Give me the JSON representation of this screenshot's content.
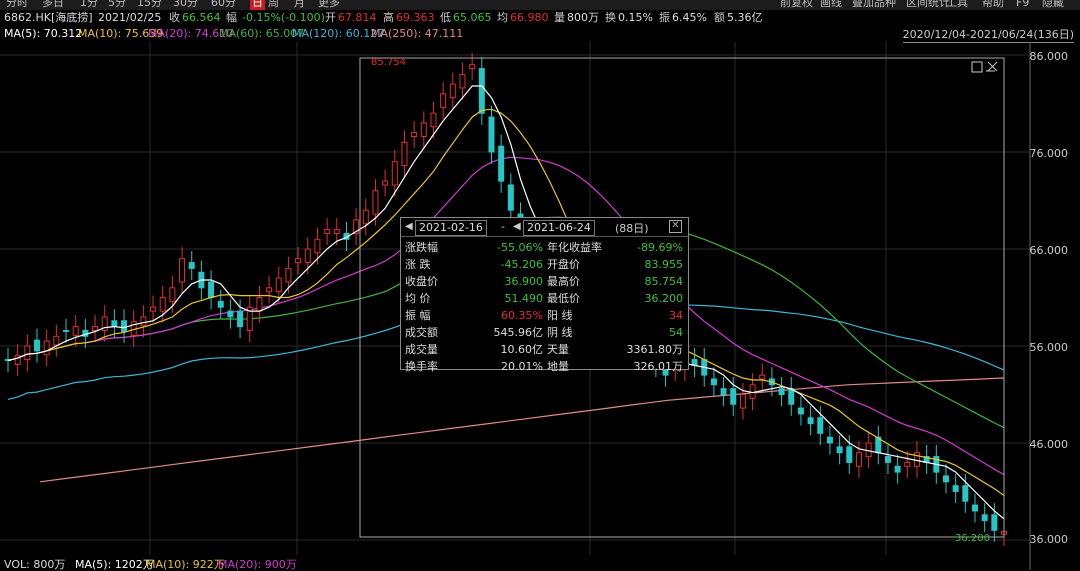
{
  "toolbar": {
    "periods": [
      "分时",
      "多日",
      "1分",
      "5分",
      "15分",
      "30分",
      "60分",
      "日",
      "周",
      "月",
      "更多"
    ],
    "active_period": "日",
    "right_buttons": [
      "前复权",
      "画线",
      "叠加品种",
      "区间统计",
      "工具",
      "帮助",
      "F9",
      "隐藏"
    ]
  },
  "info": {
    "symbol": "6862.HK[海底捞]",
    "date": "2021/02/25",
    "close_label": "收",
    "close": "66.564",
    "change_label": "幅",
    "change": "-0.15%(-0.100)",
    "open_label": "开",
    "open": "67.814",
    "high_label": "高",
    "high": "69.363",
    "low_label": "低",
    "low": "65.065",
    "avg_label": "均",
    "avg": "66.980",
    "volume_label": "量",
    "volume": "800万",
    "turnover_label": "换",
    "turnover": "0.15%",
    "amplitude_label": "振",
    "amplitude": "6.45%",
    "amount_label": "额",
    "amount": "5.36亿"
  },
  "ma": [
    {
      "label": "MA(5): 70.312",
      "color": "#ffffff"
    },
    {
      "label": "MA(10): 75.639",
      "color": "#e8c430"
    },
    {
      "label": "MA(20): 74.610",
      "color": "#d23cd2"
    },
    {
      "label": "MA(60): 65.007",
      "color": "#3fb43f"
    },
    {
      "label": "MA(120): 60.127",
      "color": "#3fb4d6"
    },
    {
      "label": "MA(250): 47.111",
      "color": "#e08a8a"
    }
  ],
  "range_label": "2020/12/04-2021/06/24(136日)",
  "y_axis": [
    "86.000",
    "76.000",
    "66.000",
    "56.000",
    "46.000",
    "36.000"
  ],
  "max_label": "85.754",
  "min_label": "36.200",
  "tooltip": {
    "start_date": "2021-02-16",
    "separator": "-",
    "end_date": "2021-06-24",
    "days": "(88日)",
    "left": [
      {
        "label": "涨跌幅",
        "value": "-55.06%",
        "color": "#3fc03f"
      },
      {
        "label": "涨  跌",
        "value": "-45.206",
        "color": "#3fc03f"
      },
      {
        "label": "收盘价",
        "value": "36.900",
        "color": "#3fc03f"
      },
      {
        "label": "均  价",
        "value": "51.490",
        "color": "#3fc03f"
      },
      {
        "label": "振  幅",
        "value": "60.35%",
        "color": "#e03030"
      },
      {
        "label": "成交额",
        "value": "545.96亿",
        "color": "#dddddd"
      },
      {
        "label": "成交量",
        "value": "10.60亿",
        "color": "#dddddd"
      },
      {
        "label": "换手率",
        "value": "20.01%",
        "color": "#dddddd"
      }
    ],
    "right": [
      {
        "label": "年化收益率",
        "value": "-89.69%",
        "color": "#3fc03f"
      },
      {
        "label": "开盘价",
        "value": "83.955",
        "color": "#3fc03f"
      },
      {
        "label": "最高价",
        "value": "85.754",
        "color": "#3fc03f"
      },
      {
        "label": "最低价",
        "value": "36.200",
        "color": "#3fc03f"
      },
      {
        "label": "阳  线",
        "value": "34",
        "color": "#e03030"
      },
      {
        "label": "阴  线",
        "value": "54",
        "color": "#3fc03f"
      },
      {
        "label": "天量",
        "value": "3361.80万",
        "color": "#dddddd"
      },
      {
        "label": "地量",
        "value": "326.01万",
        "color": "#dddddd"
      }
    ]
  },
  "volume_row": {
    "vol": "VOL: 800万",
    "ma5": "MA(5): 1202万",
    "ma10": "MA(10): 922万",
    "ma20": "MA(20): 900万"
  },
  "chart_data": {
    "type": "line",
    "x_start": "2020/12/04",
    "x_end": "2021/06/24",
    "ylim": [
      36,
      86
    ],
    "closes": [
      54.5,
      55,
      56,
      55.5,
      56.5,
      57,
      57.5,
      58,
      57,
      58,
      59,
      58,
      57.5,
      58.5,
      59,
      60,
      61,
      62,
      65,
      64,
      62,
      61,
      60,
      59,
      58,
      60,
      61,
      62,
      63,
      64,
      65,
      66,
      67,
      68,
      68,
      67,
      69,
      70,
      72,
      73,
      75,
      77,
      78,
      79,
      80,
      82,
      83,
      84,
      85,
      80,
      76,
      73,
      70,
      67,
      66,
      65,
      64,
      63,
      62,
      61,
      60,
      59,
      58,
      57,
      56,
      55,
      55,
      54,
      53,
      54,
      55,
      54,
      53,
      52,
      51,
      50,
      51,
      52,
      53,
      52,
      51,
      50,
      49,
      48,
      47,
      46,
      45,
      44,
      45,
      46,
      45,
      44,
      43,
      44,
      45,
      44,
      43,
      42,
      41,
      40,
      39,
      38,
      37,
      36.9
    ],
    "ma250": [
      42,
      42.3,
      42.6,
      42.9,
      43.2,
      43.5,
      43.8,
      44.1,
      44.4,
      44.7,
      45,
      45.3,
      45.6,
      45.9,
      46.2,
      46.5,
      46.8,
      47.1,
      47.4,
      47.7,
      48,
      48.3,
      48.6,
      48.9,
      49.2,
      49.5,
      49.8,
      50.1,
      50.4,
      50.6,
      50.8,
      51,
      51.2,
      51.4,
      51.6,
      51.8,
      52,
      52.1,
      52.2,
      52.3,
      52.4,
      52.5,
      52.6,
      52.7
    ]
  }
}
